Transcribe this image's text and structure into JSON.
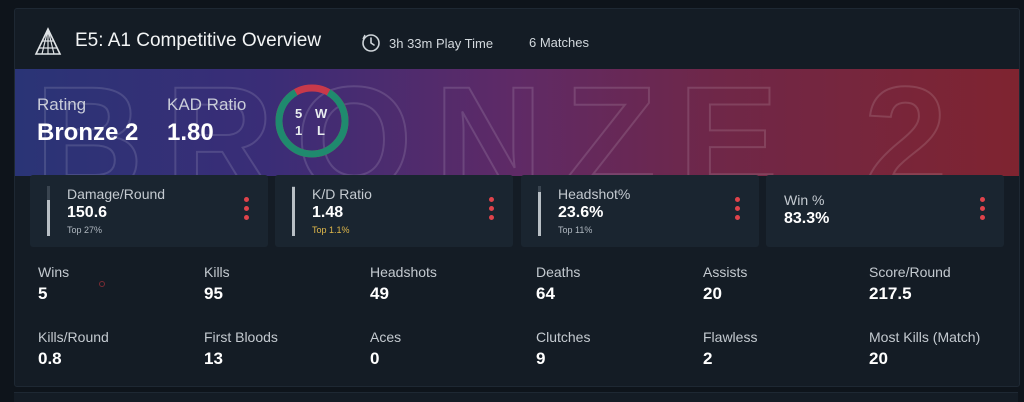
{
  "header": {
    "title": "E5: A1 Competitive Overview",
    "playtime": "3h 33m Play Time",
    "matches": "6 Matches"
  },
  "banner": {
    "watermark": "BRONZE 2",
    "rating_label": "Rating",
    "rating_value": "Bronze 2",
    "kad_label": "KAD Ratio",
    "kad_value": "1.80",
    "wins": "5",
    "losses": "1",
    "w_label": "W",
    "l_label": "L",
    "win_fraction": 0.833
  },
  "cards": [
    {
      "label": "Damage/Round",
      "value": "150.6",
      "sub": "Top 27%",
      "bar": 0.73
    },
    {
      "label": "K/D Ratio",
      "value": "1.48",
      "sub": "Top 1.1%",
      "bar": 0.989
    },
    {
      "label": "Headshot%",
      "value": "23.6%",
      "sub": "Top 11%",
      "bar": 0.89
    },
    {
      "label": "Win %",
      "value": "83.3%"
    }
  ],
  "stats": [
    {
      "label": "Wins",
      "value": "5"
    },
    {
      "label": "Kills",
      "value": "95"
    },
    {
      "label": "Headshots",
      "value": "49"
    },
    {
      "label": "Deaths",
      "value": "64"
    },
    {
      "label": "Assists",
      "value": "20"
    },
    {
      "label": "Score/Round",
      "value": "217.5"
    },
    {
      "label": "Kills/Round",
      "value": "0.8"
    },
    {
      "label": "First Bloods",
      "value": "13"
    },
    {
      "label": "Aces",
      "value": "0"
    },
    {
      "label": "Clutches",
      "value": "9"
    },
    {
      "label": "Flawless",
      "value": "2"
    },
    {
      "label": "Most Kills (Match)",
      "value": "20"
    }
  ],
  "colors": {
    "accent_red": "#e0434b",
    "ring_win": "#1f8a6e",
    "ring_loss": "#c8394a",
    "gold": "#e0b84a"
  }
}
